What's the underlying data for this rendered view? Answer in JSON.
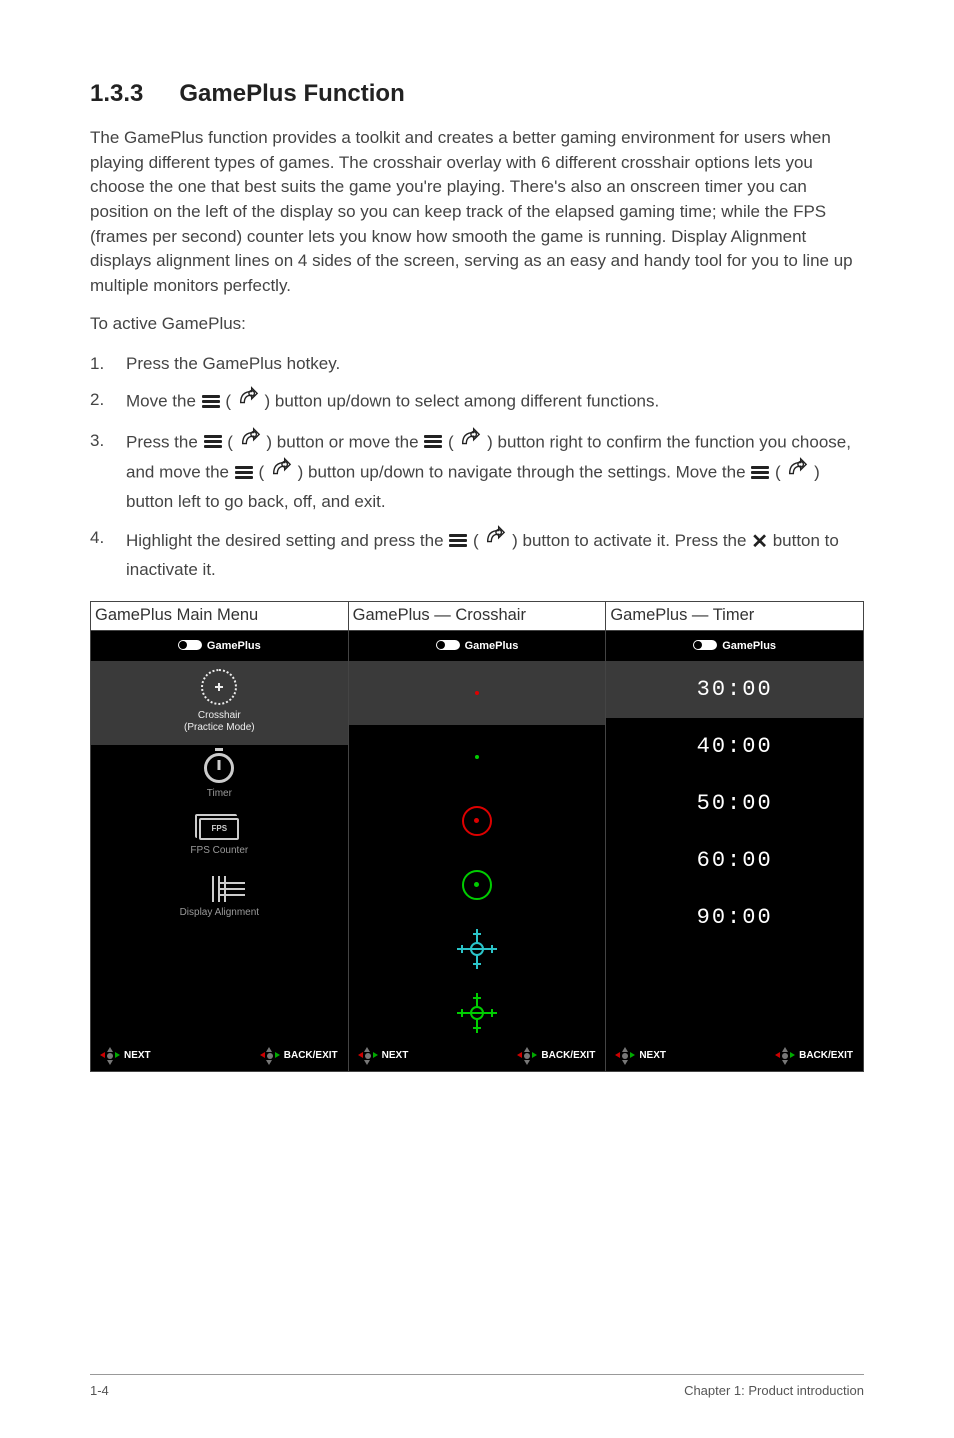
{
  "heading": {
    "number": "1.3.3",
    "title": "GamePlus Function"
  },
  "intro": "The GamePlus function provides a toolkit and creates a better gaming environment for users when playing different types of games. The crosshair overlay with 6 different crosshair options lets you choose the one that best suits the game you're playing. There's also an onscreen timer you can position on the left of the display so you can keep track of the elapsed gaming time; while the FPS (frames per second) counter lets you know how smooth the game is running. Display Alignment displays alignment lines on 4 sides of the screen, serving as an easy and handy tool for you to line up multiple monitors perfectly.",
  "lead": "To active GamePlus:",
  "steps": {
    "s1_num": "1.",
    "s1": "Press the GamePlus hotkey.",
    "s2_num": "2.",
    "s2a": "Move the ",
    "s2b": " ( ",
    "s2c": " ) button up/down to select among different functions.",
    "s3_num": "3.",
    "s3a": "Press the ",
    "s3b": " ( ",
    "s3c": " ) button or move the ",
    "s3d": " ( ",
    "s3e": " ) button right to confirm the function you choose, and move the ",
    "s3f": " ( ",
    "s3g": " ) button up/down to navigate through the settings. Move the ",
    "s3h": " ( ",
    "s3i": " ) button left to go back, off, and exit.",
    "s4_num": "4.",
    "s4a": "Highlight the desired setting and press the ",
    "s4b": " ( ",
    "s4c": " ) button to activate it. Press the ",
    "s4d": " button to inactivate it."
  },
  "panels": {
    "h1": "GamePlus Main Menu",
    "h2": "GamePlus — Crosshair",
    "h3": "GamePlus — Timer",
    "gp_title": "GamePlus",
    "main": {
      "crosshair": "Crosshair\n(Practice Mode)",
      "timer": "Timer",
      "fps": "FPS",
      "fps_label": "FPS Counter",
      "align": "Display Alignment"
    },
    "timer": {
      "t1": "30:00",
      "t2": "40:00",
      "t3": "50:00",
      "t4": "60:00",
      "t5": "90:00"
    },
    "footer": {
      "next": "NEXT",
      "back": "BACK/EXIT"
    }
  },
  "page_footer": {
    "left": "1-4",
    "right": "Chapter 1: Product introduction"
  }
}
